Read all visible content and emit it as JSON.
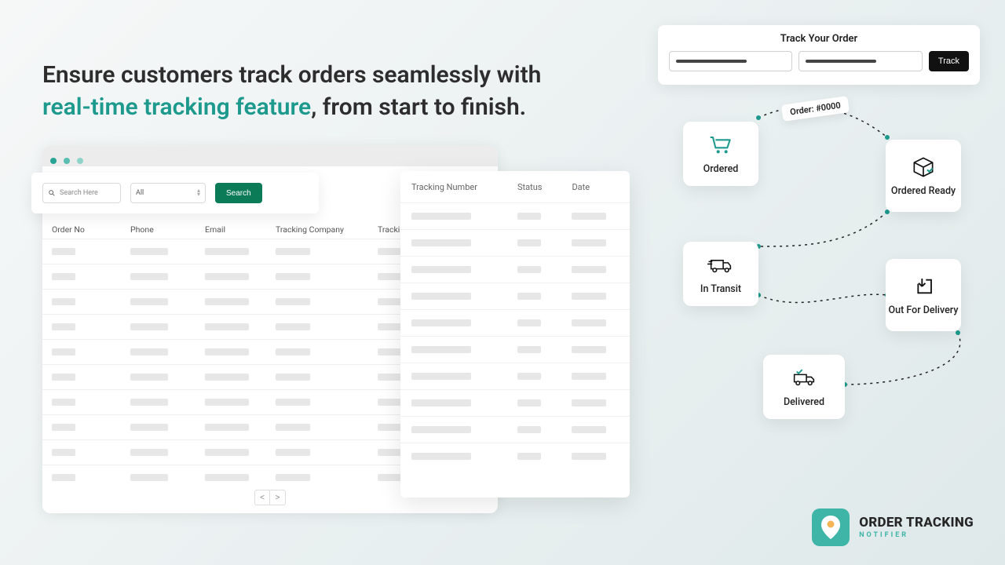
{
  "headline": {
    "pre": "Ensure customers track orders seamlessly with ",
    "accent": "real-time tracking feature",
    "post": ", from start to finish."
  },
  "toolbar": {
    "search_placeholder": "Search Here",
    "dropdown_value": "All",
    "search_btn": "Search"
  },
  "columns": {
    "order_no": "Order No",
    "phone": "Phone",
    "email": "Email",
    "tracking_company": "Tracking Company",
    "tracking_number_short": "Tracking"
  },
  "front_columns": {
    "tracking_number": "Tracking Number",
    "status": "Status",
    "date": "Date"
  },
  "pager": {
    "prev": "<",
    "next": ">"
  },
  "track_widget": {
    "title": "Track Your Order",
    "btn": "Track"
  },
  "order_chip": "Order: #0000",
  "flow": {
    "ordered": "Ordered",
    "ready": "Ordered Ready",
    "transit": "In Transit",
    "outfor": "Out For Delivery",
    "delivered": "Delivered"
  },
  "brand": {
    "name": "ORDER TRACKING",
    "sub": "NOTIFIER"
  }
}
